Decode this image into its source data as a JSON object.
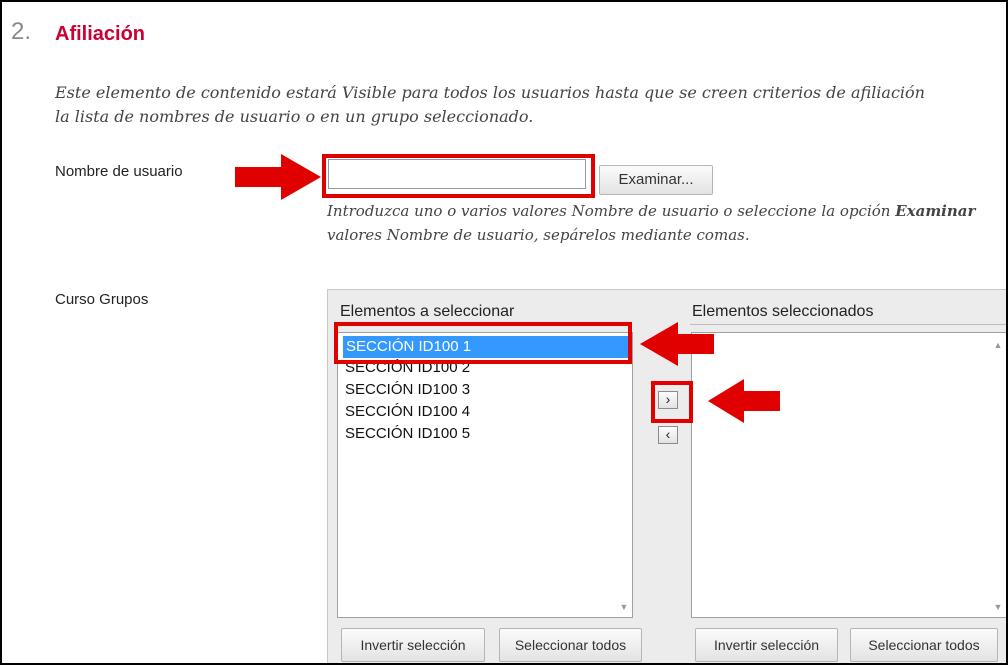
{
  "section": {
    "number": "2.",
    "title": "Afiliación",
    "description_line1": "Este elemento de contenido estará Visible para todos los usuarios hasta que se creen criterios de afiliación",
    "description_line2": "la lista de nombres de usuario o en un grupo seleccionado."
  },
  "username": {
    "label": "Nombre de usuario",
    "value": "",
    "browse_label": "Examinar...",
    "hint_line1_pre": "Introduzca uno o varios valores Nombre de usuario o seleccione la opción ",
    "hint_line1_bold": "Examinar",
    "hint_line2": "valores Nombre de usuario, sepárelos mediante comas."
  },
  "groups": {
    "label": "Curso Grupos",
    "available_header": "Elementos a seleccionar",
    "selected_header": "Elementos seleccionados",
    "available_items": [
      "SECCIÓN ID100 1",
      "SECCIÓN ID100 2",
      "SECCIÓN ID100 3",
      "SECCIÓN ID100 4",
      "SECCIÓN ID100 5"
    ],
    "selected_items": [],
    "move_right": "›",
    "move_left": "‹",
    "invert_label": "Invertir selección",
    "select_all_label": "Seleccionar todos"
  },
  "colors": {
    "accent": "#cc0033",
    "highlight": "#e00000",
    "selection": "#3399ff"
  }
}
